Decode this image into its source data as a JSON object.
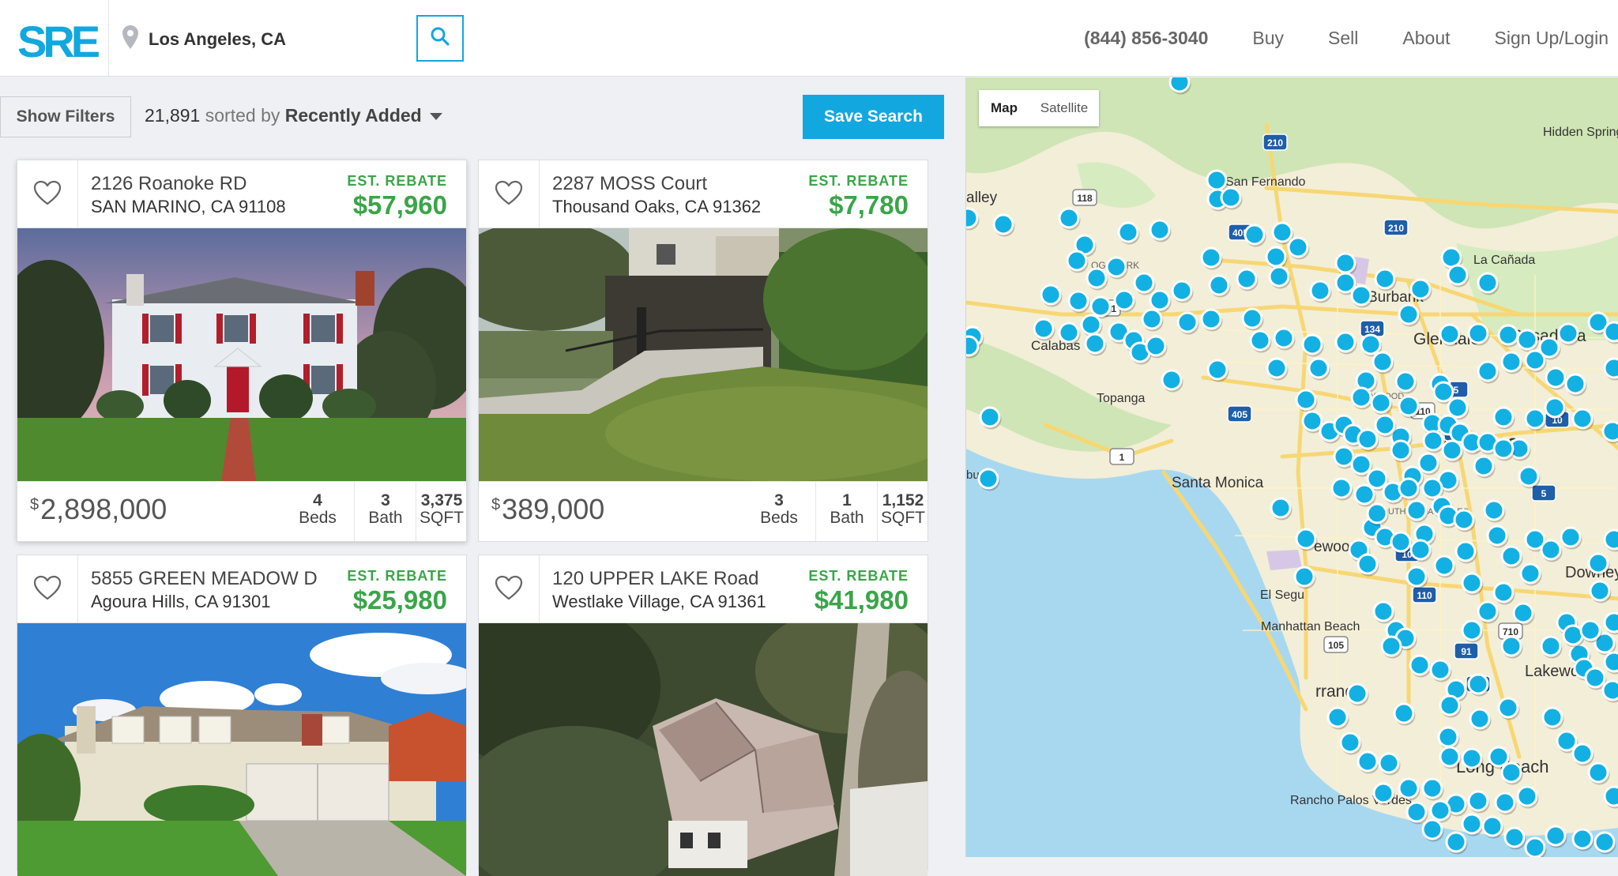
{
  "header": {
    "logo_text": "SRE",
    "location_value": "Los Angeles, CA",
    "phone": "(844) 856-3040",
    "nav": [
      "Buy",
      "Sell",
      "About",
      "Sign Up/Login"
    ]
  },
  "toolbar": {
    "filters_label": "Show Filters",
    "result_count": "21,891",
    "sorted_by_text": "sorted by",
    "sort_value": "Recently Added",
    "save_search_label": "Save Search"
  },
  "listings": [
    {
      "address": "2126 Roanoke RD",
      "city": "SAN MARINO, CA 91108",
      "rebate_label": "EST. REBATE",
      "rebate": "$57,960",
      "currency": "$",
      "price": "2,898,000",
      "beds": "4",
      "beds_label": "Beds",
      "baths": "3",
      "baths_label": "Bath",
      "sqft": "3,375",
      "sqft_label": "SQFT"
    },
    {
      "address": "2287 MOSS Court",
      "city": "Thousand Oaks, CA 91362",
      "rebate_label": "EST. REBATE",
      "rebate": "$7,780",
      "currency": "$",
      "price": "389,000",
      "beds": "3",
      "beds_label": "Beds",
      "baths": "1",
      "baths_label": "Bath",
      "sqft": "1,152",
      "sqft_label": "SQFT"
    },
    {
      "address": "5855 GREEN MEADOW D",
      "city": "Agoura Hills, CA 91301",
      "rebate_label": "EST. REBATE",
      "rebate": "$25,980"
    },
    {
      "address": "120 UPPER LAKE Road",
      "city": "Westlake Village, CA 91361",
      "rebate_label": "EST. REBATE",
      "rebate": "$41,980"
    }
  ],
  "map": {
    "mode_map": "Map",
    "mode_satellite": "Satellite",
    "colors": {
      "land": "#f3eed8",
      "water": "#a8d8ef",
      "green": "#cfe5b5",
      "highway": "#f7d774",
      "marker": "#13b0e3"
    },
    "labels": {
      "valley": "alley",
      "calabasas": "Calabas",
      "topanga": "Topanga",
      "malibu": "bu",
      "canoga": "OGA PARK",
      "san_fernando": "San Fernando",
      "burbank": "Burbank",
      "glendale": "Glendale",
      "pasadena": "Pasadena",
      "la_canada": "La Cañada",
      "hidden_springs": "Hidden Springs",
      "hollywood": "LLYWOOD",
      "los_angeles": "Angeles",
      "santa_monica": "Santa Monica",
      "south_la": "SOUTH LOS ANGELES",
      "inglewood": "ewood",
      "el_segundo": "El Segu",
      "manhattan": "Manhattan Beach",
      "downey": "Downey",
      "torrance": "rrance",
      "lakewood": "Lakewo",
      "long_beach": "Long Beach",
      "rancho": "Rancho Palos Verdes",
      "shields": [
        "210",
        "118",
        "405",
        "210",
        "101",
        "134",
        "5",
        "110",
        "405",
        "10",
        "1",
        "5",
        "110",
        "710",
        "91",
        "405",
        "105",
        "10",
        "5"
      ]
    }
  }
}
